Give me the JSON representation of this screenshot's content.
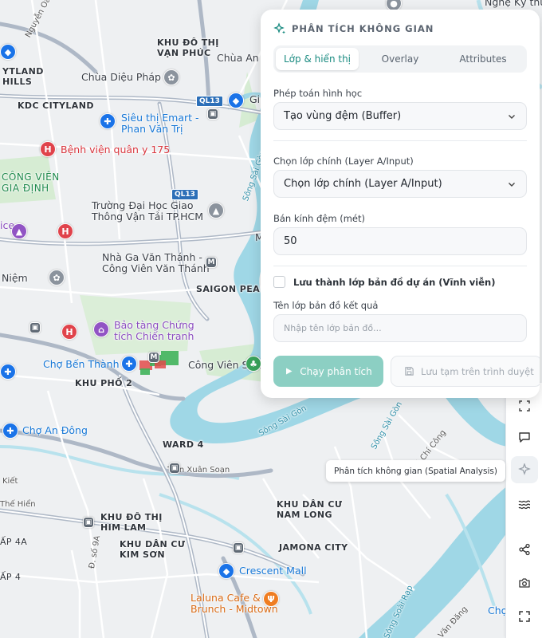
{
  "map": {
    "labels": {
      "khu_do_thi_van_phuc": "KHU ĐÔ THỊ\nVẠN PHÚC",
      "chua_an": "Chùa An",
      "ytland_hills": "YTLAND\nHILLS",
      "chua_dieu_phap": "Chùa Diệu Pháp",
      "nguyen_oanh": "Nguyễn Oanh",
      "kdc_cityland": "KDC CITYLAND",
      "emart": "Siêu thị Emart -\nPhan Văn Trị",
      "bv_quan_y": "Bệnh viện quân y 175",
      "cong_vien_gia_dinh": "CÔNG VIÊN\nGIA ĐỊNH",
      "truong_gtvt": "Trường Đại Học Giao\nThông Vận Tải TP.HCM",
      "ga_van_thanh": "Nhà Ga Văn Thánh -\nCông Viên Văn Thánh",
      "saigon_pearl": "SAIGON PEARL",
      "chua_hoang_phap": "Niệm",
      "bao_tang": "Bảo tàng Chứng\ntích Chiến tranh",
      "cho_ben_thanh": "Chợ Bến Thành",
      "cong_vien_sala": "Công Viên Sala",
      "khu_pho_2": "KHU PHỐ 2",
      "cho_an_dong": "Chợ An Đông",
      "ward_4": "WARD 4",
      "tran_xuan_soan": "Trần Xuân Soạn",
      "khu_do_thi_him_lam": "KHU ĐÔ THỊ\nHIM LAM",
      "kdc_nam_long": "KHU DÂN CƯ\nNAM LONG",
      "kdc_kim_son": "KHU DÂN CƯ\nKIM SƠN",
      "jamona_city": "JAMONA CITY",
      "crescent_mall": "Crescent Mall",
      "laluna": "Laluna Cafe &\nBrunch - Midtown",
      "ap_4a": "ẤP 4A",
      "ap_4": "ẤP 4",
      "song_sai_gon_1": "Sông Sài Gòn",
      "song_sai_gon_2": "Sông Sài Gòn",
      "song_sai_gon_3": "Sông Sài Gòn",
      "song_soai_rap": "Sông Soài Rạp",
      "vo_chi_cong": "Võ Chí Công",
      "the_hien": "Thế Hiển",
      "kiet": "Kiết",
      "ql13_1": "QL13",
      "ql13_2": "QL13",
      "ql1": "1",
      "ngo_ky_thuat": "Nghệ Kỹ thu",
      "tien_van_dang": "Văn Đăng",
      "cho": "Chợ",
      "ice": "ice",
      "duong_9a": "Đ. số 9A",
      "m": "M",
      "gi": "Gi"
    }
  },
  "panel": {
    "title": "PHÂN TÍCH KHÔNG GIAN",
    "tabs": [
      "Lớp & hiển thị",
      "Overlay",
      "Attributes"
    ],
    "operation_label": "Phép toán hình học",
    "operation_value": "Tạo vùng đệm (Buffer)",
    "layer_label": "Chọn lớp chính (Layer A/Input)",
    "layer_value": "Chọn lớp chính (Layer A/Input)",
    "radius_label": "Bán kính đệm (mét)",
    "radius_value": "50",
    "save_layer_label": "Lưu thành lớp bản đồ dự án (Vĩnh viễn)",
    "result_name_label": "Tên lớp bản đồ kết quả",
    "result_name_placeholder": "Nhập tên lớp bản đồ...",
    "run_button": "Chạy phân tích",
    "temp_save_button": "Lưu tạm trên trình duyệt"
  },
  "tooltip": "Phân tích không gian (Spatial Analysis)",
  "colors": {
    "accent": "#1c8c82",
    "run_button": "#8ccfc3",
    "water": "#9fd7e6",
    "park": "#cfe9cc"
  }
}
